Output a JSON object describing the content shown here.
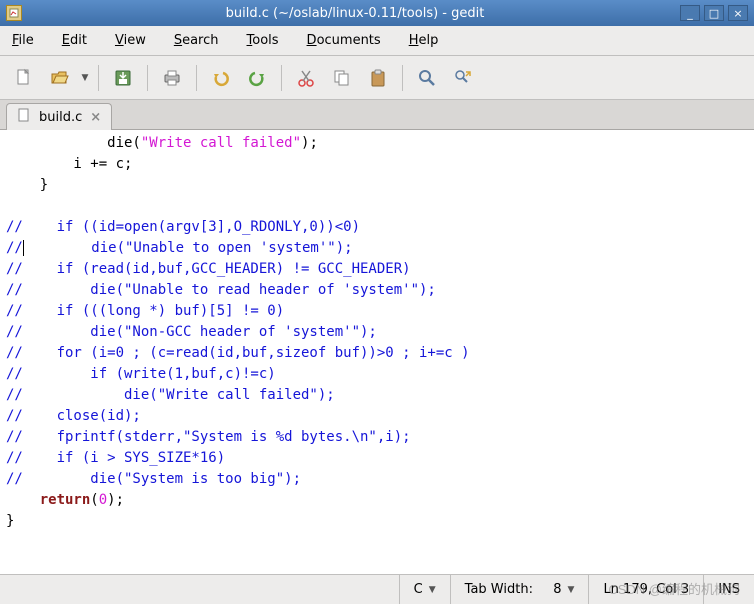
{
  "window": {
    "title": "build.c (~/oslab/linux-0.11/tools) - gedit",
    "min": "_",
    "max": "□",
    "close": "×"
  },
  "menu": {
    "file": "File",
    "edit": "Edit",
    "view": "View",
    "search": "Search",
    "tools": "Tools",
    "documents": "Documents",
    "help": "Help"
  },
  "toolbar_icons": {
    "new": "new-file-icon",
    "open": "open-folder-icon",
    "save": "save-icon",
    "print": "print-icon",
    "undo": "undo-icon",
    "redo": "redo-icon",
    "cut": "cut-icon",
    "copy": "copy-icon",
    "paste": "paste-icon",
    "find": "find-icon",
    "replace": "replace-icon"
  },
  "tab": {
    "label": "build.c",
    "close": "×"
  },
  "code": {
    "l1a": "            die(",
    "l1s": "\"Write call failed\"",
    "l1b": ");",
    "l2": "        i += c;",
    "l3": "    }",
    "l4": "",
    "l5": "//    if ((id=open(argv[3],O_RDONLY,0))<0)",
    "l6a": "//",
    "l6b": "        die(\"Unable to open 'system'\");",
    "l7": "//    if (read(id,buf,GCC_HEADER) != GCC_HEADER)",
    "l8": "//        die(\"Unable to read header of 'system'\");",
    "l9": "//    if (((long *) buf)[5] != 0)",
    "l10": "//        die(\"Non-GCC header of 'system'\");",
    "l11": "//    for (i=0 ; (c=read(id,buf,sizeof buf))>0 ; i+=c )",
    "l12": "//        if (write(1,buf,c)!=c)",
    "l13": "//            die(\"Write call failed\");",
    "l14": "//    close(id);",
    "l15": "//    fprintf(stderr,\"System is %d bytes.\\n\",i);",
    "l16": "//    if (i > SYS_SIZE*16)",
    "l17": "//        die(\"System is too big\");",
    "l18a": "    ",
    "l18kw": "return",
    "l18b": "(",
    "l18n": "0",
    "l18c": ");",
    "l19": "}"
  },
  "status": {
    "lang": "C",
    "tabwidth_label": "Tab Width:",
    "tabwidth_value": "8",
    "position": "Ln 179, Col 3",
    "ins": "INS"
  },
  "watermark": "CSDN @编程的机械狗"
}
